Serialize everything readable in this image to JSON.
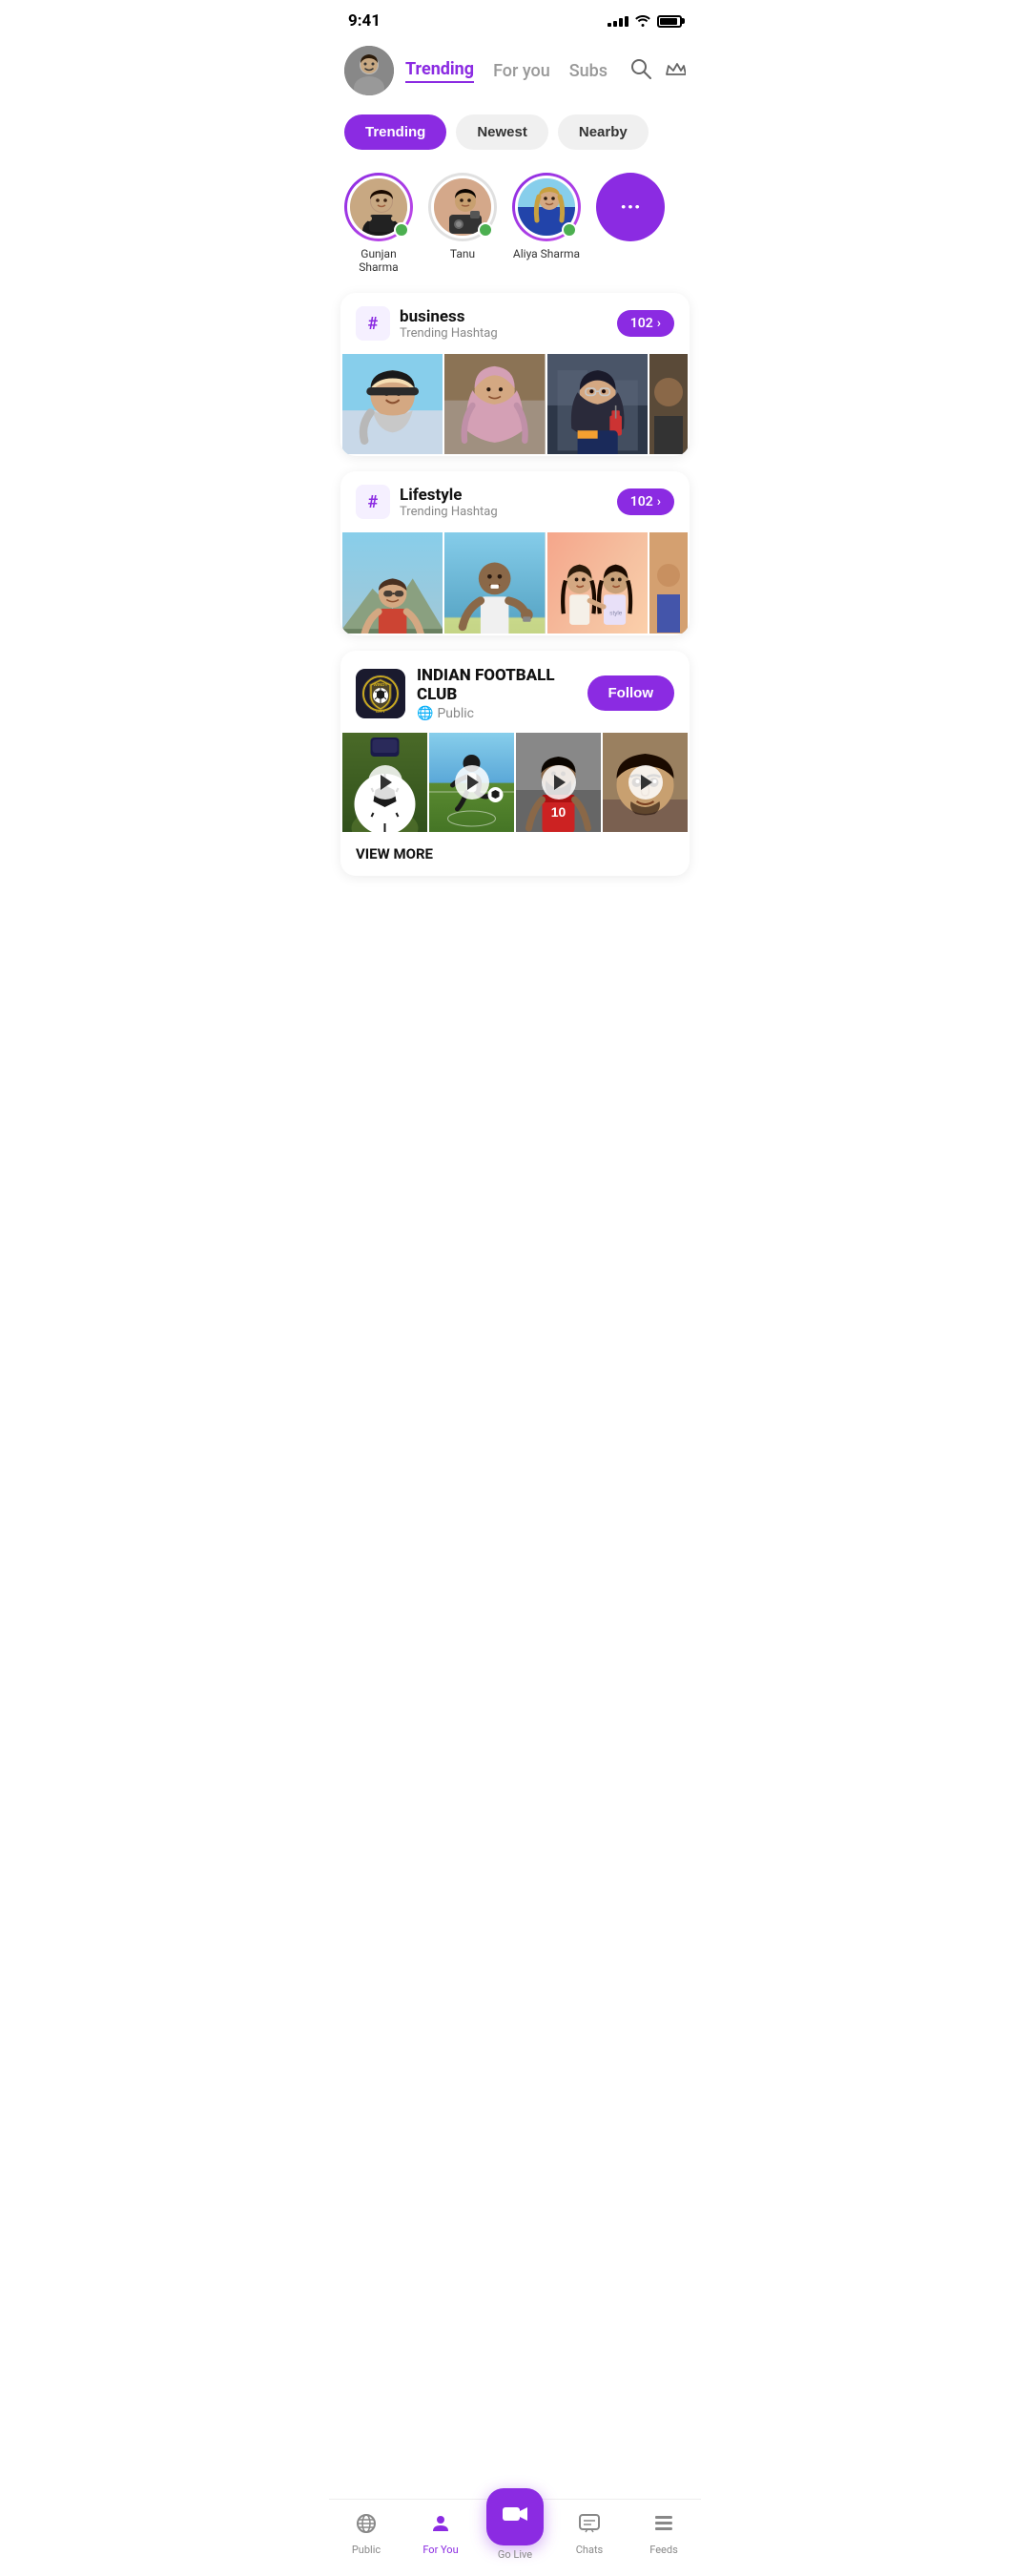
{
  "statusBar": {
    "time": "9:41",
    "signalBars": [
      3,
      5,
      7,
      9,
      11
    ],
    "battery": 90
  },
  "header": {
    "tabs": [
      {
        "id": "trending",
        "label": "Trending",
        "active": true
      },
      {
        "id": "foryou",
        "label": "For you",
        "active": false
      },
      {
        "id": "subs",
        "label": "Subs",
        "active": false
      }
    ]
  },
  "filters": [
    {
      "id": "trending",
      "label": "Trending",
      "active": true
    },
    {
      "id": "newest",
      "label": "Newest",
      "active": false
    },
    {
      "id": "nearby",
      "label": "Nearby",
      "active": false
    }
  ],
  "stories": [
    {
      "id": "gunjan",
      "name": "Gunjan Sharma",
      "hasRing": true,
      "online": true
    },
    {
      "id": "tanu",
      "name": "Tanu",
      "hasRing": false,
      "online": true
    },
    {
      "id": "aliya",
      "name": "Aliya Sharma",
      "hasRing": true,
      "online": true
    },
    {
      "id": "more",
      "name": "more",
      "isMore": true
    }
  ],
  "hashtagCards": [
    {
      "id": "business",
      "tag": "business",
      "sub": "Trending Hashtag",
      "count": "102",
      "images": [
        "person-warm",
        "person-hijab-pink",
        "person-hijab-dark",
        "person-partial"
      ]
    },
    {
      "id": "lifestyle",
      "tag": "Lifestyle",
      "sub": "Trending Hashtag",
      "count": "102",
      "images": [
        "guy-outdoor",
        "guy-beach",
        "girls-smiling",
        "partial"
      ]
    }
  ],
  "clubCard": {
    "name": "INDIAN FOOTBALL CLUB",
    "type": "Public",
    "typeIcon": "🌐",
    "followLabel": "Follow",
    "viewMoreLabel": "VIEW MORE",
    "videos": [
      "football-ball",
      "football-kick",
      "football-player",
      "face-closeup"
    ]
  },
  "bottomNav": [
    {
      "id": "public",
      "label": "Public",
      "icon": "📡",
      "active": false
    },
    {
      "id": "foryou",
      "label": "For You",
      "icon": "👤",
      "active": true
    },
    {
      "id": "golive",
      "label": "Go Live",
      "icon": "🎥",
      "isCenter": true
    },
    {
      "id": "chats",
      "label": "Chats",
      "icon": "💬",
      "active": false
    },
    {
      "id": "feeds",
      "label": "Feeds",
      "icon": "≡",
      "active": false
    }
  ],
  "colors": {
    "primary": "#8B2BE2",
    "active": "#8B2BE2",
    "inactive": "#888",
    "green": "#4CAF50"
  }
}
